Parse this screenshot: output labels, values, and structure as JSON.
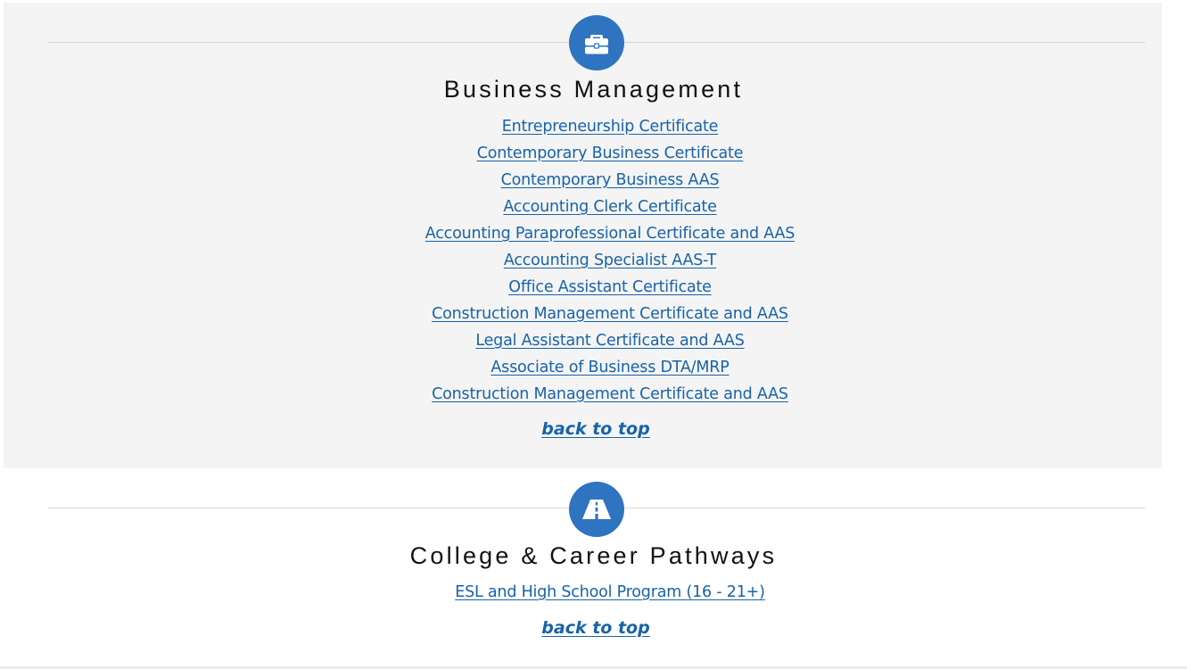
{
  "sections": [
    {
      "icon": "briefcase-icon",
      "title": "Business Management",
      "links": [
        "Entrepreneurship Certificate",
        "Contemporary Business Certificate",
        "Contemporary Business AAS",
        "Accounting Clerk Certificate",
        "Accounting Paraprofessional Certificate and AAS",
        "Accounting Specialist AAS-T",
        "Office Assistant Certificate",
        "Construction Management Certificate and AAS",
        "Legal Assistant Certificate and AAS",
        "Associate of Business DTA/MRP",
        "Construction Management Certificate and AAS"
      ],
      "back_to_top": "back to top"
    },
    {
      "icon": "road-icon",
      "title": "College & Career Pathways",
      "links": [
        "ESL and High School Program (16 - 21+)"
      ],
      "back_to_top": "back to top"
    }
  ],
  "colors": {
    "accent": "#2f74c0",
    "link": "#1763a8",
    "section_bg": "#f4f4f4"
  }
}
